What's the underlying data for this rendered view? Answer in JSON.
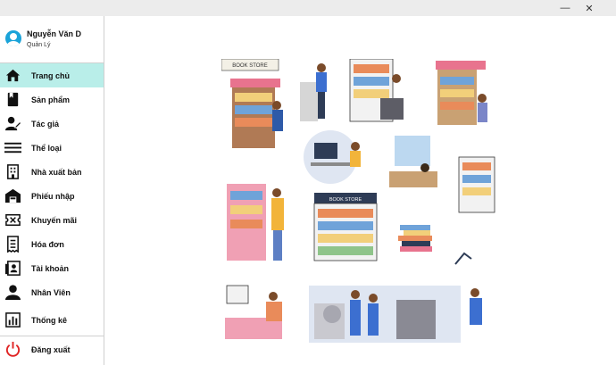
{
  "window": {
    "minimize_label": "—",
    "close_label": "✕"
  },
  "user": {
    "name": "Nguyễn Văn D",
    "role": "Quản Lý",
    "avatar_icon": "user-circle-icon"
  },
  "nav": {
    "items": [
      {
        "label": "Trang chủ",
        "icon": "home-icon",
        "active": true
      },
      {
        "label": "Sản phẩm",
        "icon": "book-icon"
      },
      {
        "label": "Tác giả",
        "icon": "author-icon"
      },
      {
        "label": "Thể loại",
        "icon": "menu-lines-icon"
      },
      {
        "label": "Nhà xuất bản",
        "icon": "publisher-icon"
      },
      {
        "label": "Phiếu nhập",
        "icon": "warehouse-icon"
      },
      {
        "label": "Khuyến mãi",
        "icon": "ticket-icon"
      },
      {
        "label": "Hóa đơn",
        "icon": "receipt-icon"
      },
      {
        "label": "Tài khoản",
        "icon": "account-book-icon"
      },
      {
        "label": "Nhân Viên",
        "icon": "employee-icon"
      },
      {
        "label": "Thống kê",
        "icon": "stats-icon"
      }
    ],
    "logout_label": "Đăng xuất",
    "logout_icon": "power-icon",
    "active_color": "#b9eee9",
    "logout_color": "#e02424"
  },
  "illustration": {
    "signs": [
      "BOOK STORE",
      "BOOK STORE"
    ],
    "icon": "bookstore-illustration"
  }
}
